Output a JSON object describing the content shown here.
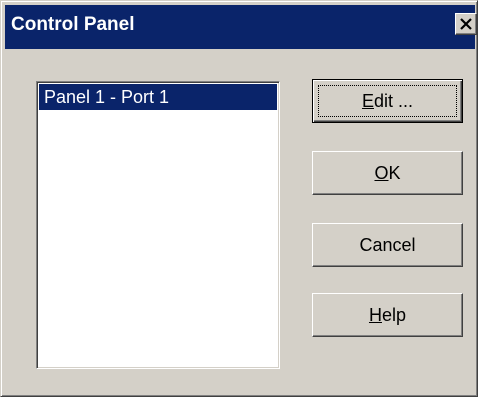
{
  "window": {
    "title": "Control Panel"
  },
  "list": {
    "items": [
      {
        "label": "Panel 1 - Port 1",
        "selected": true
      }
    ]
  },
  "buttons": {
    "edit": {
      "accel": "E",
      "rest": "dit ..."
    },
    "ok": {
      "accel": "O",
      "rest": "K"
    },
    "cancel": {
      "label": "Cancel"
    },
    "help": {
      "accel": "H",
      "rest": "elp"
    }
  },
  "icons": {
    "close": "close-icon"
  },
  "colors": {
    "titlebar": "#0a246a",
    "face": "#d4d0c8",
    "selection": "#0a246a"
  }
}
